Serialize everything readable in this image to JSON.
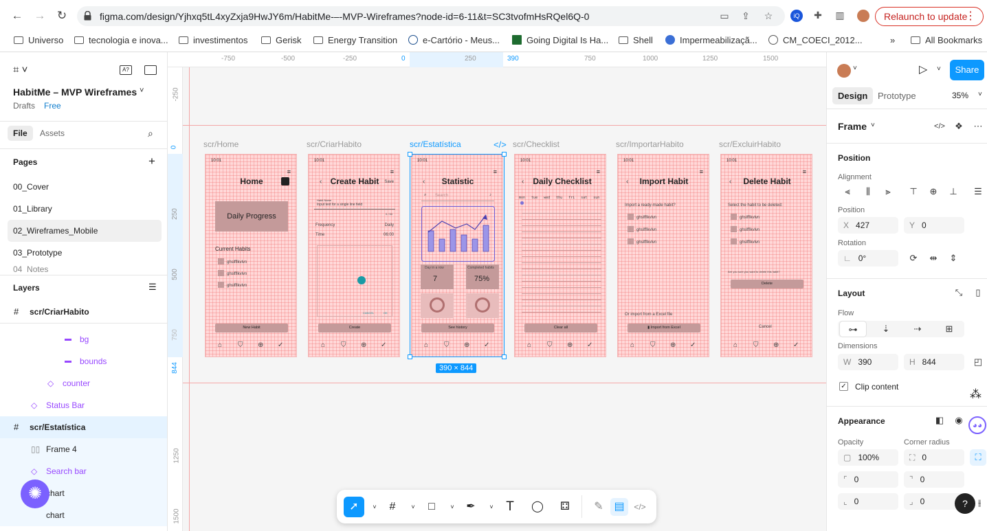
{
  "browser": {
    "url": "figma.com/design/Yjhxq5tL4xyZxja9HwJY6m/HabitMe-–-MVP-Wireframes?node-id=6-11&t=SC3tvofmHsRQel6Q-0",
    "relaunch": "Relaunch to update",
    "bookmarks": [
      "Universo",
      "tecnologia e inova...",
      "investimentos",
      "Gerisk",
      "Energy Transition",
      "e-Cartório - Meus...",
      "Going Digital Is Ha...",
      "Shell",
      "Impermeabilizaçã...",
      "CM_COECI_2012...",
      "All Bookmarks"
    ],
    "more": "»"
  },
  "left": {
    "file_name": "HabitMe – MVP Wireframes",
    "drafts": "Drafts",
    "plan": "Free",
    "tabs": [
      "File",
      "Assets"
    ],
    "pages_title": "Pages",
    "pages": [
      "00_Cover",
      "01_Library",
      "02_Wireframes_Mobile",
      "03_Prototype",
      "04_Notes"
    ],
    "layers_title": "Layers",
    "layers": [
      "scr/CriarHabito",
      "bg",
      "bounds",
      "counter",
      "Status Bar",
      "scr/Estatística",
      "Frame 4",
      "Search bar",
      "chart",
      "chart"
    ]
  },
  "canvas": {
    "ruler_x": [
      "-750",
      "-500",
      "-250",
      "0",
      "250",
      "390",
      "750",
      "1000",
      "1250",
      "1500"
    ],
    "ruler_y": [
      "-250",
      "0",
      "250",
      "500",
      "750",
      "844",
      "1250",
      "1500"
    ],
    "size_badge": "390 × 844",
    "frames": [
      {
        "label": "scr/Home",
        "title": "Home"
      },
      {
        "label": "scr/CriarHabito",
        "title": "Create Habit"
      },
      {
        "label": "scr/Estatística",
        "title": "Statistic"
      },
      {
        "label": "scr/Checklist",
        "title": "Daily Checklist"
      },
      {
        "label": "scr/ImportarHabito",
        "title": "Import Habit"
      },
      {
        "label": "scr/ExcluirHabito",
        "title": "Delete Habit"
      }
    ],
    "home": {
      "progress": "Daily Progress",
      "current": "Current Habits",
      "habits": [
        "ghslfflkvlvn",
        "ghslfflkvlvn",
        "ghslfflkvlvn"
      ],
      "button": "New Habit"
    },
    "create": {
      "save": "Save",
      "name_label": "Habit Name",
      "name_value": "Input text for a single line field",
      "counter": "0 / 50",
      "frequency": "Frequency",
      "frequency_value": "Daily",
      "time": "Time",
      "time_value": "06:00",
      "cancel": "CANCEL",
      "ok": "OK",
      "button": "Create"
    },
    "stat": {
      "search": "Search",
      "day_label": "Day in a row",
      "day_value": "7",
      "completed_label": "Completed habits",
      "completed_value": "75%",
      "button": "See history"
    },
    "check": {
      "days": [
        "mon",
        "tue",
        "wed",
        "thu",
        "fri",
        "sat",
        "sun"
      ],
      "button": "Clear all"
    },
    "import": {
      "question": "Import a ready-made habit?",
      "habits": [
        "ghslfflkvlvn",
        "ghslfflkvlvn",
        "ghslfflkvlvn"
      ],
      "excel": "Or import from a Excel file",
      "button": "Import from Excel"
    },
    "del": {
      "question": "Select the habit to be deleted:",
      "habits": [
        "ghslfflkvlvn",
        "ghslfflkvlvn",
        "ghslfflkvlvn"
      ],
      "confirm": "Are you sure you want to delete this habit?",
      "button": "Delete",
      "cancel": "Cancel"
    },
    "status_time": "10:01"
  },
  "right": {
    "share": "Share",
    "tabs": [
      "Design",
      "Prototype"
    ],
    "zoom": "35%",
    "frame_label": "Frame",
    "position_title": "Position",
    "alignment": "Alignment",
    "position": "Position",
    "x": "427",
    "y": "0",
    "rotation_label": "Rotation",
    "rotation": "0°",
    "layout_title": "Layout",
    "flow": "Flow",
    "dimensions": "Dimensions",
    "w": "390",
    "h": "844",
    "clip": "Clip content",
    "appearance": "Appearance",
    "opacity_label": "Opacity",
    "opacity": "100%",
    "radius_label": "Corner radius",
    "radius": "0",
    "r1": "0",
    "r2": "0",
    "r3": "0",
    "r4": "0"
  },
  "colors": {
    "accent": "#0d99ff",
    "frame_fill": "#ffd8d8",
    "guide": "#f4a6a6"
  }
}
